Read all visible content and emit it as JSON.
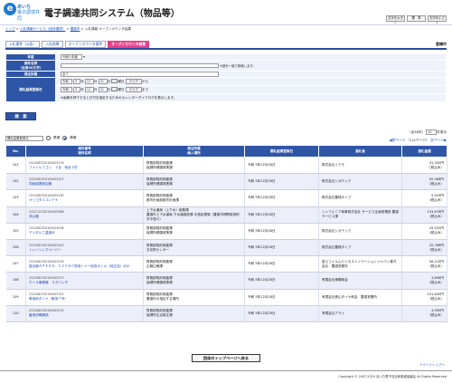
{
  "header": {
    "logo_letter": "e",
    "logo_line1": "あいち",
    "logo_line2": "電子調達共同",
    "title": "電子調達共同システム（物品等）",
    "font_buttons": [
      "文字を大きく",
      "標　準",
      "文字を小さく"
    ]
  },
  "breadcrumb": {
    "items": [
      "トップ",
      "入札情報サービス（団体選択）",
      "豊橋市",
      "入札情報 オープンカウンタ結果"
    ],
    "separator": " > "
  },
  "tabs": [
    {
      "label": "入札案件（公告）",
      "active": false
    },
    {
      "label": "入札結果",
      "active": false
    },
    {
      "label": "オープンカウンタ案件",
      "active": false
    },
    {
      "label": "オープンカウンタ結果",
      "active": true
    }
  ],
  "organization": "豊橋市",
  "form": {
    "year_label": "年度",
    "year_value": "令和５年度",
    "case_name_label": "案件名称",
    "case_name_sub": "（全角30文字）",
    "case_name_value": "",
    "case_name_note": "※部分一致で検索します。",
    "department_label": "発注所属",
    "department_value": "全て",
    "date_label": "開札結果登録日",
    "date_from": {
      "era": "令和",
      "year": "5",
      "month": "12",
      "day": "01",
      "clear": "クリア",
      "suffix": "から",
      "dow": "曜日"
    },
    "date_to": {
      "era": "令和",
      "year": "5",
      "month": "12",
      "day": "31",
      "clear": "クリア",
      "suffix": "まで",
      "dow": "曜日"
    },
    "year_unit": "年",
    "month_unit": "月",
    "day_unit": "日",
    "date_note": "※画像を押下すると日付を指定するためのカレンダーダイアログを表示します。",
    "search_button": "検　索"
  },
  "sort": {
    "field": "開札結果登録日",
    "ascending": "昇順",
    "descending": "降順",
    "selected": "降順"
  },
  "paging": {
    "summary": "（全38件）",
    "per_page": "10",
    "per_page_unit": "件",
    "count_suffix": "表示",
    "prev": "前ページ",
    "pages": "（1/4ページ）",
    "next": "次ページ"
  },
  "table": {
    "columns": [
      "No.",
      "案件番号\n案件名称",
      "発注所属\n納入場所",
      "開札結果登録日",
      "落札者",
      "落札金額"
    ],
    "rows": [
      {
        "no": "101",
        "case_no": "2312082320100003176",
        "name": "ファイルワゴン　２台　他余２件",
        "dept": "財務部契約検査課",
        "place": "保健所健康政策課",
        "date": "令和 5年12月28日",
        "winner": "株式会社イクモ",
        "price": "31,350円",
        "tax": "（税込み）"
      },
      {
        "no": "102",
        "case_no": "2312082320100003107",
        "name": "同級強悪殺定器",
        "dept": "財務部契約検査課",
        "place": "保健所健康政策課",
        "date": "令和 5年12月28日",
        "winner": "株式会社シガテック",
        "price": "92,568円",
        "tax": "（税込み）"
      },
      {
        "no": "103",
        "case_no": "2312082320100003195",
        "name": "オリゴタミコンテナ",
        "dept": "財務部契約検査課",
        "place": "都市計画部都市計画課",
        "date": "令和 5年12月28日",
        "winner": "株式会社豊橋タイプ",
        "price": "5,529円",
        "tax": "（税込み）"
      },
      {
        "no": "104",
        "case_no": "2312112320100003586",
        "name": "消火器",
        "dept": "上下水道局（上下水）総務課",
        "place": "豊橋市上下水道局 下水道施設課 中島処理場（豊橋市神野新田町字中島ロ）",
        "date": "令和 5年12月28日",
        "winner": "シンフォニア商事株式会社 サービス企画営業部 豊橋サービス課",
        "price": "133,676円",
        "tax": "（税込み）"
      },
      {
        "no": "105",
        "case_no": "2312082320100003038",
        "name": "デジタル三温度計",
        "dept": "財務部契約検査課",
        "place": "保健所健康政策課",
        "date": "令和 5年12月28日",
        "winner": "株式会社シガテック",
        "price": "25,520円",
        "tax": "（税込み）"
      },
      {
        "no": "106",
        "case_no": "2312082320100003240",
        "name": "トレーシングペーパー",
        "dept": "財務部契約検査課",
        "place": "文化財センター",
        "date": "令和 5年12月28日",
        "winner": "株式会社豊橋タイプ",
        "price": "20,768円",
        "tax": "（税込み）"
      },
      {
        "no": "107",
        "case_no": "2312082320100003239",
        "name": "複合機ＡＰＥＯＳ　Ｃ２０６０型用トナー回収ボトル（純正品）ほか",
        "dept": "財務部契約検査課",
        "place": "広報広聴課",
        "date": "令和 5年12月28日",
        "winner": "富士フイルムビジネスイノベーションジャパン株式会社　豊橋営業所",
        "price": "56,210円",
        "tax": "（税込み）"
      },
      {
        "no": "108",
        "case_no": "2312082320100003273",
        "name": "ホール事務機　２ガバンチ",
        "dept": "財務部契約検査課",
        "place": "保健所健康政策課",
        "date": "令和 5年12月28日",
        "winner": "有限会社東陽商会",
        "price": "3,696円",
        "tax": "（税込み）"
      },
      {
        "no": "109",
        "case_no": "2312082320100003322",
        "name": "車両用タイヤ（乗用７号）",
        "dept": "財務部契約検査課",
        "place": "豊橋市の指定する場所",
        "date": "令和 5年12月28日",
        "winner": "有限会社奥山タイヤ商会　豊橋営業所",
        "price": "101,640円",
        "tax": "（税込み）"
      },
      {
        "no": "110",
        "case_no": "2312082320100003132",
        "name": "番用消毒器検",
        "dept": "財務部契約検査課",
        "place": "保健所生活衛生課",
        "date": "令和 5年12月28日",
        "winner": "有限会社アライ",
        "price": "4,999円",
        "tax": "（税込み）"
      }
    ]
  },
  "back_button": "団体のトップページへ戻る",
  "page_top": "ページトップへ",
  "copyright": "Copyright © 2007-2024 あいち電子自治体推進協議会 All Rights Reserved"
}
